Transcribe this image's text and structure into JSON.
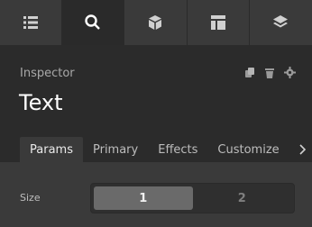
{
  "toolbar": {
    "tools": [
      {
        "icon": "list-icon",
        "active": false
      },
      {
        "icon": "search-icon",
        "active": true
      },
      {
        "icon": "cube-icon",
        "active": false
      },
      {
        "icon": "layout-icon",
        "active": false
      },
      {
        "icon": "layers-icon",
        "active": false
      }
    ]
  },
  "header": {
    "section_label": "Inspector",
    "title": "Text",
    "actions": [
      "copy-icon",
      "trash-icon",
      "gear-icon"
    ]
  },
  "tabs": [
    {
      "label": "Params",
      "active": true
    },
    {
      "label": "Primary",
      "active": false
    },
    {
      "label": "Effects",
      "active": false
    },
    {
      "label": "Customize",
      "active": false
    }
  ],
  "params": {
    "size_label": "Size",
    "size_options": [
      "1",
      "2"
    ],
    "size_selected": "1"
  },
  "colors": {
    "background": "#2f2f2f",
    "toolbar": "#3a3a3a",
    "active_tab": "#3a3a3a",
    "selected_segment": "#6a6a6a"
  }
}
